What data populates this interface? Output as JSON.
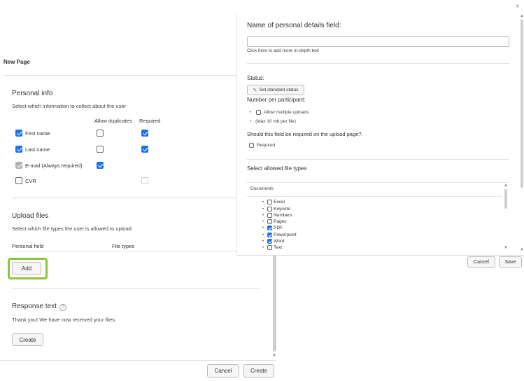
{
  "left": {
    "page_title": "New Page",
    "personal_info": {
      "title": "Personal info",
      "subtitle": "Select which information to collect about the user",
      "col_allow_duplicates": "Allow duplicates",
      "col_required": "Required",
      "rows": [
        {
          "label": "First name",
          "include": true,
          "allow_duplicates": false,
          "required": true
        },
        {
          "label": "Last name",
          "include": true,
          "allow_duplicates": false,
          "required": true
        },
        {
          "label": "E-mail (Always required)",
          "include": true,
          "allow_duplicates": true,
          "required": null
        },
        {
          "label": "CVR",
          "include": false,
          "allow_duplicates": null,
          "required": false
        }
      ]
    },
    "upload_files": {
      "title": "Upload files",
      "subtitle": "Select which file types the user is allowed to upload",
      "col_personal_field": "Personal field",
      "col_file_types": "File types",
      "add_label": "Add"
    },
    "response_text": {
      "title": "Response text",
      "help_icon": "?",
      "body": "Thank you! We have now received your files.",
      "create_label": "Create"
    },
    "footer": {
      "cancel_label": "Cancel",
      "create_label": "Create"
    }
  },
  "right": {
    "name_label": "Name of personal details field:",
    "name_value": "",
    "in_depth_link": "Click here to add more in-depth text",
    "status_label": "Status:",
    "set_status_label": "Set standard status",
    "number_label": "Number per participant:",
    "allow_multiple_label": "Allow multiple uploads",
    "max_size_note": "(Max 10 mb per file)",
    "required_question": "Should this field be required on the upload page?:",
    "required_label": "Required",
    "allowed_types_label": "Select allowed file types",
    "documents_label": "Documents",
    "file_types": [
      {
        "label": "Excel",
        "checked": false
      },
      {
        "label": "Keynote",
        "checked": false
      },
      {
        "label": "Numbers",
        "checked": false
      },
      {
        "label": "Pages",
        "checked": false
      },
      {
        "label": "PDF",
        "checked": true
      },
      {
        "label": "Powerpoint",
        "checked": true
      },
      {
        "label": "Word",
        "checked": true
      },
      {
        "label": "Text",
        "checked": false
      }
    ],
    "cancel_label": "Cancel",
    "save_label": "Save",
    "close_icon": "×"
  },
  "colors": {
    "accent": "#1a73e8",
    "highlight": "#8cc43c"
  }
}
